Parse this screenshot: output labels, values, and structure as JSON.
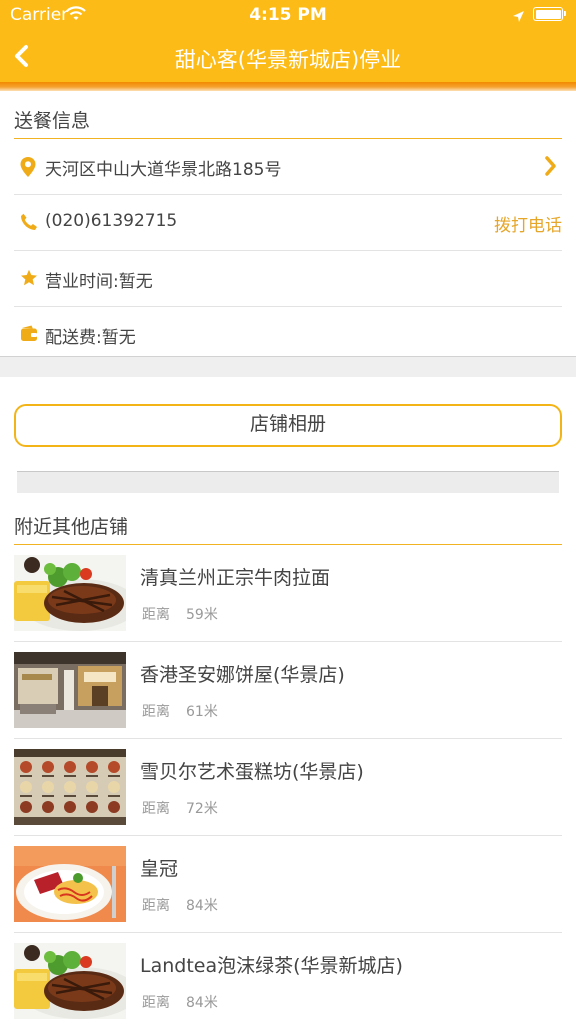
{
  "status": {
    "carrier": "Carrier",
    "time": "4:15 PM"
  },
  "nav": {
    "title": "甜心客(华景新城店)停业"
  },
  "delivery": {
    "section_title": "送餐信息",
    "address": "天河区中山大道华景北路185号",
    "phone": "(020)61392715",
    "call_label": "拨打电话",
    "hours": "营业时间:暂无",
    "fee": "配送费:暂无"
  },
  "album_button": "店铺相册",
  "nearby": {
    "section_title": "附近其他店铺",
    "distance_label": "距离",
    "stores": [
      {
        "name": "清真兰州正宗牛肉拉面",
        "distance": "59米",
        "thumb": "steak-photo"
      },
      {
        "name": "香港圣安娜饼屋(华景店)",
        "distance": "61米",
        "thumb": "bakery-storefront-photo"
      },
      {
        "name": "雪贝尔艺术蛋糕坊(华景店)",
        "distance": "72米",
        "thumb": "cake-menu-photo"
      },
      {
        "name": "皇冠",
        "distance": "84米",
        "thumb": "plated-dish-photo"
      },
      {
        "name": "Landtea泡沫绿茶(华景新城店)",
        "distance": "84米",
        "thumb": "steak-photo"
      }
    ]
  },
  "colors": {
    "brand": "#fdbb17",
    "accent": "#e6a62a"
  }
}
